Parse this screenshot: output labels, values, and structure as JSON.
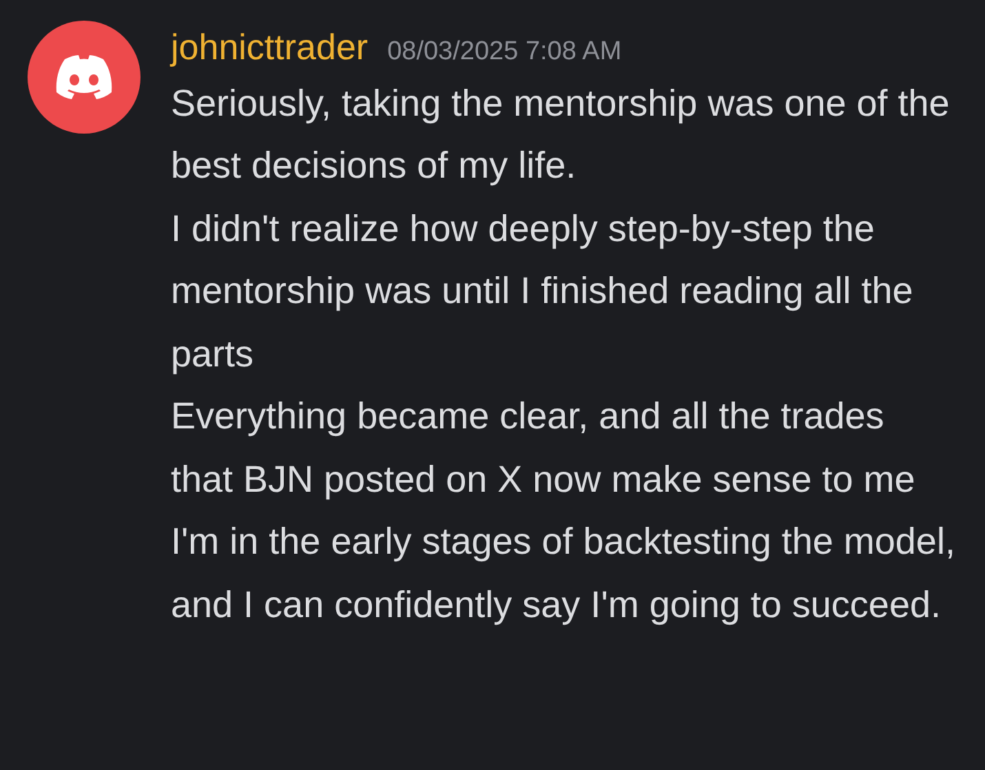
{
  "message": {
    "author": "johnicttrader",
    "timestamp": "08/03/2025 7:08 AM",
    "paragraphs": [
      "Seriously, taking the mentorship was one of the best decisions of my life.",
      "I didn't realize how deeply step-by-step the mentorship was until I finished reading all the parts",
      "Everything became clear, and all the trades that BJN posted on X now make sense to me",
      "I'm in the early stages of backtesting the model, and I can confidently say I'm going to succeed."
    ]
  }
}
